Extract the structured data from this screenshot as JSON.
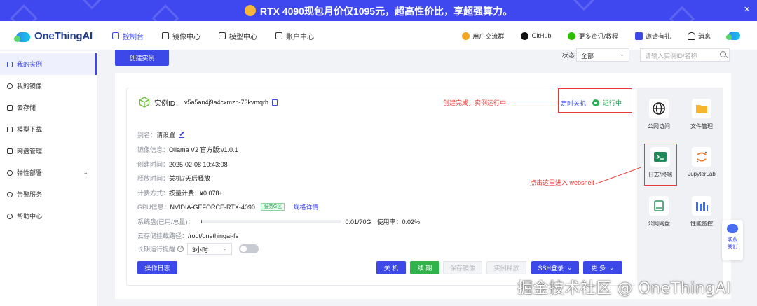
{
  "banner": {
    "text": "RTX 4090现包月价仅1095元，超高性价比，享超强算力。",
    "close": "×"
  },
  "brand": {
    "name": "OneThingAI"
  },
  "nav": {
    "items": [
      {
        "label": "控制台",
        "active": true
      },
      {
        "label": "镜像中心",
        "active": false
      },
      {
        "label": "模型中心",
        "active": false
      },
      {
        "label": "账户中心",
        "active": false
      }
    ],
    "right": [
      {
        "label": "用户交流群",
        "icon": "chat-icon"
      },
      {
        "label": "GitHub",
        "icon": "github-icon"
      },
      {
        "label": "更多资讯/教程",
        "icon": "wechat-icon"
      },
      {
        "label": "邀请有礼",
        "icon": "gift-icon"
      },
      {
        "label": "消息",
        "icon": "bell-icon"
      }
    ]
  },
  "sidebar": {
    "items": [
      {
        "label": "我的实例",
        "active": true
      },
      {
        "label": "我的镜像",
        "active": false
      },
      {
        "label": "云存储",
        "active": false
      },
      {
        "label": "模型下载",
        "active": false
      },
      {
        "label": "网盘管理",
        "active": false
      },
      {
        "label": "弹性部署",
        "active": false,
        "chevron": "⌄"
      },
      {
        "label": "告警服务",
        "active": false
      },
      {
        "label": "帮助中心",
        "active": false
      }
    ]
  },
  "toolbar": {
    "create": "创建实例",
    "status_label": "状态",
    "status_value": "全部",
    "search_placeholder": "请输入实例ID/名称"
  },
  "instance": {
    "id_label": "实例ID：",
    "id": "v5a5an4j9a4cxmzp-73kvmqrh",
    "stop": "定时关机",
    "status": "运行中",
    "rows": {
      "alias": {
        "k": "别名：",
        "v": "请设置"
      },
      "image": {
        "k": "镜像信息：",
        "v": "Ollama V2 官方版:v1.0.1"
      },
      "created": {
        "k": "创建时间：",
        "v": "2025-02-08 10:43:08"
      },
      "release": {
        "k": "释放时间：",
        "v": "关机7天后释放"
      },
      "billing": {
        "k": "计费方式：",
        "v": "按量计费",
        "price": "¥0.078+"
      },
      "gpu": {
        "k": "GPU信息：",
        "v": "NVIDIA-GEFORCE-RTX-4090",
        "tag": "服务G区",
        "link": "规格详情"
      },
      "disk": {
        "k": "系统盘(已用/总量)：",
        "v": "0.01/70G",
        "usage_label": "使用率：",
        "usage": "0.02%",
        "usage_fraction": 0.0002
      },
      "mount": {
        "k": "云存储挂载路径：",
        "v": "/root/onethingai-fs"
      },
      "reminder": {
        "k": "长期运行提醒",
        "hint": "?",
        "v": "3小时",
        "toggle_on": false
      }
    },
    "buttons": {
      "log": "操作日志",
      "shutdown": "关 机",
      "renew": "续 期",
      "save_image": "保存镜像",
      "release": "实例释放",
      "ssh": "SSH登录",
      "more": "更 多"
    }
  },
  "annotations": {
    "created": "创建完成，实例运行中",
    "webshell": "点击这里进入 webshell"
  },
  "tools": [
    {
      "label": "公网访问",
      "icon": "globe-icon"
    },
    {
      "label": "文件管理",
      "icon": "folder-icon"
    },
    {
      "label": "日志/终端",
      "icon": "terminal-icon"
    },
    {
      "label": "JupyterLab",
      "icon": "jupyter-icon"
    },
    {
      "label": "公网网盘",
      "icon": "drive-icon"
    },
    {
      "label": "性能监控",
      "icon": "chart-icon"
    }
  ],
  "contact": {
    "line1": "联系",
    "line2": "我们"
  },
  "watermark": "掘金技术社区 @ OneThingAI",
  "colors": {
    "accent": "#3c49e8",
    "banner": "#3f48ee",
    "success": "#23b350",
    "annotation": "#e43b35"
  }
}
